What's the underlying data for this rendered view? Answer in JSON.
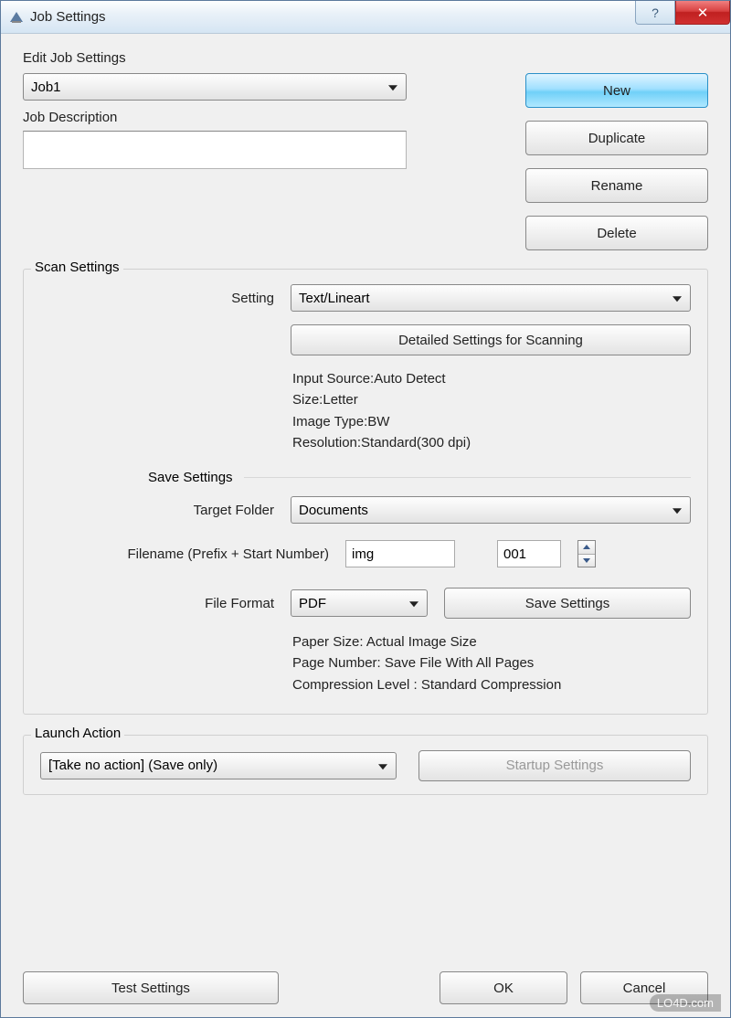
{
  "window": {
    "title": "Job Settings"
  },
  "edit": {
    "heading": "Edit Job Settings",
    "job_select": "Job1",
    "desc_label": "Job Description",
    "desc_value": ""
  },
  "buttons": {
    "new": "New",
    "duplicate": "Duplicate",
    "rename": "Rename",
    "delete": "Delete"
  },
  "scan": {
    "legend": "Scan Settings",
    "setting_label": "Setting",
    "setting_value": "Text/Lineart",
    "detailed_btn": "Detailed Settings for Scanning",
    "info1": "Input Source:Auto Detect",
    "info2": "Size:Letter",
    "info3": "Image Type:BW",
    "info4": "Resolution:Standard(300 dpi)"
  },
  "save": {
    "heading": "Save Settings",
    "target_label": "Target Folder",
    "target_value": "Documents",
    "filename_label": "Filename (Prefix + Start Number)",
    "prefix_value": "img",
    "start_value": "001",
    "format_label": "File Format",
    "format_value": "PDF",
    "save_btn": "Save Settings",
    "info1": "Paper Size: Actual Image Size",
    "info2": "Page Number: Save File With All Pages",
    "info3": "Compression Level : Standard Compression"
  },
  "launch": {
    "legend": "Launch Action",
    "action_value": "[Take no action] (Save only)",
    "startup_btn": "Startup Settings"
  },
  "footer": {
    "test": "Test Settings",
    "ok": "OK",
    "cancel": "Cancel"
  },
  "watermark": "LO4D.com",
  "icons": {
    "help": "?",
    "close": "✕"
  }
}
